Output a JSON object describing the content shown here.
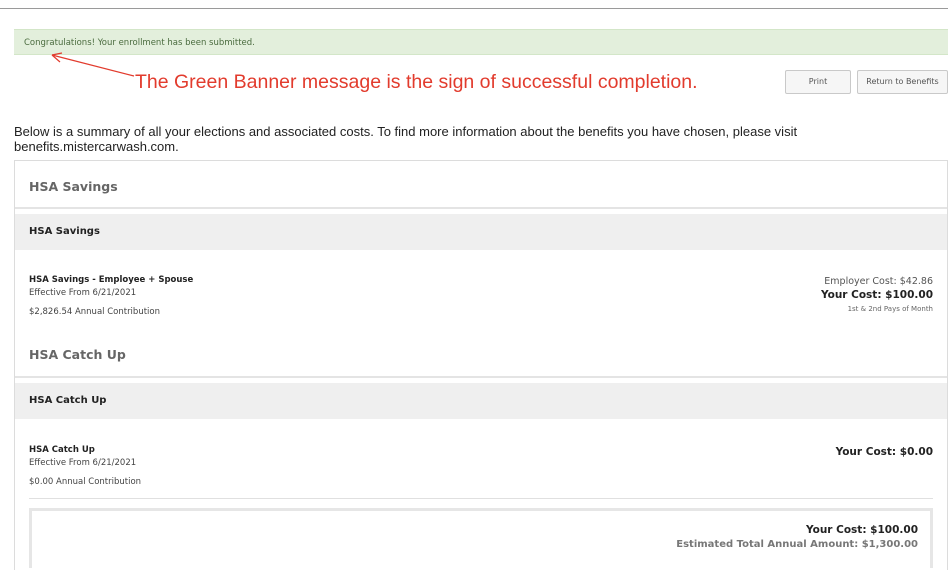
{
  "banner": {
    "message": "Congratulations! Your enrollment has been submitted."
  },
  "annotation": {
    "text": "The Green Banner message is the sign of successful completion.",
    "color": "#e23b2d"
  },
  "actions": {
    "print_label": "Print",
    "return_label": "Return to Benefits"
  },
  "intro": {
    "text": "Below is a summary of all your elections and associated costs. To find more information about the benefits you have chosen, please visit benefits.mistercarwash.com."
  },
  "sections": [
    {
      "heading": "HSA Savings",
      "card_title": "HSA Savings",
      "plan_name": "HSA Savings - Employee + Spouse",
      "effective": "Effective From 6/21/2021",
      "contribution": "$2,826.54 Annual Contribution",
      "employer_cost": "Employer Cost: $42.86",
      "your_cost": "Your Cost: $100.00",
      "pay_frequency": "1st & 2nd Pays of Month"
    },
    {
      "heading": "HSA Catch Up",
      "card_title": "HSA Catch Up",
      "plan_name": "HSA Catch Up",
      "effective": "Effective From 6/21/2021",
      "contribution": "$0.00 Annual Contribution",
      "your_cost": "Your Cost: $0.00"
    }
  ],
  "totals": {
    "your_cost": "Your Cost: $100.00",
    "estimated_annual": "Estimated Total Annual Amount: $1,300.00"
  },
  "colors": {
    "banner_bg": "#e3efdc",
    "banner_text": "#4a6b3e",
    "annotation": "#e23b2d"
  },
  "icons": {
    "annotation_arrow": "arrow-icon"
  }
}
